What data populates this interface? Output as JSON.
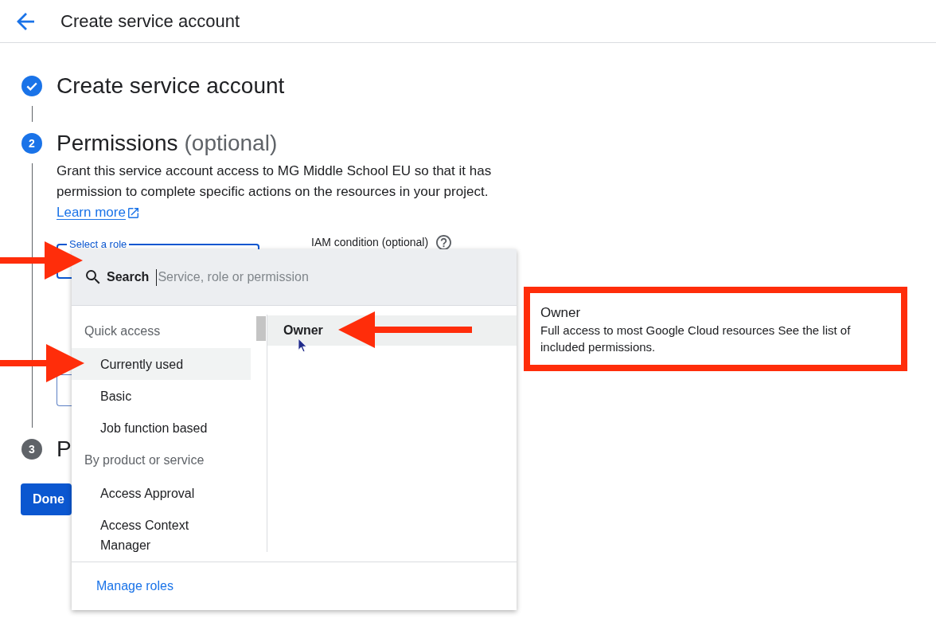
{
  "header": {
    "title": "Create service account"
  },
  "steps": [
    {
      "kind": "done",
      "title": "Create service account"
    },
    {
      "kind": "active",
      "number": "2",
      "title": "Permissions",
      "title_note": "(optional)",
      "description": "Grant this service account access to MG Middle School EU so that it has permission to complete specific actions on the resources in your project.",
      "link": "Learn more",
      "role_field": {
        "label": "Select a role"
      },
      "condition": {
        "label": "IAM condition (optional)"
      }
    },
    {
      "kind": "pending",
      "number": "3",
      "title": "P"
    }
  ],
  "done_button": {
    "label": "Done"
  },
  "role_menu": {
    "search_label": "Search",
    "placeholder": "Service, role or permission",
    "groups": [
      {
        "heading": "Quick access",
        "items": [
          {
            "label": "Currently used",
            "selected": true
          },
          {
            "label": "Basic",
            "selected": false
          },
          {
            "label": "Job function based",
            "selected": false
          }
        ]
      },
      {
        "heading": "By product or service",
        "items": [
          {
            "label": "Access Approval",
            "selected": false
          },
          {
            "label": "Access Context Manager",
            "selected": false
          }
        ]
      }
    ],
    "roles": [
      {
        "label": "Owner",
        "highlighted": true
      }
    ],
    "footer_link": "Manage roles"
  },
  "role_tooltip": {
    "title": "Owner",
    "description": "Full access to most Google Cloud resources See the list of included permissions."
  }
}
